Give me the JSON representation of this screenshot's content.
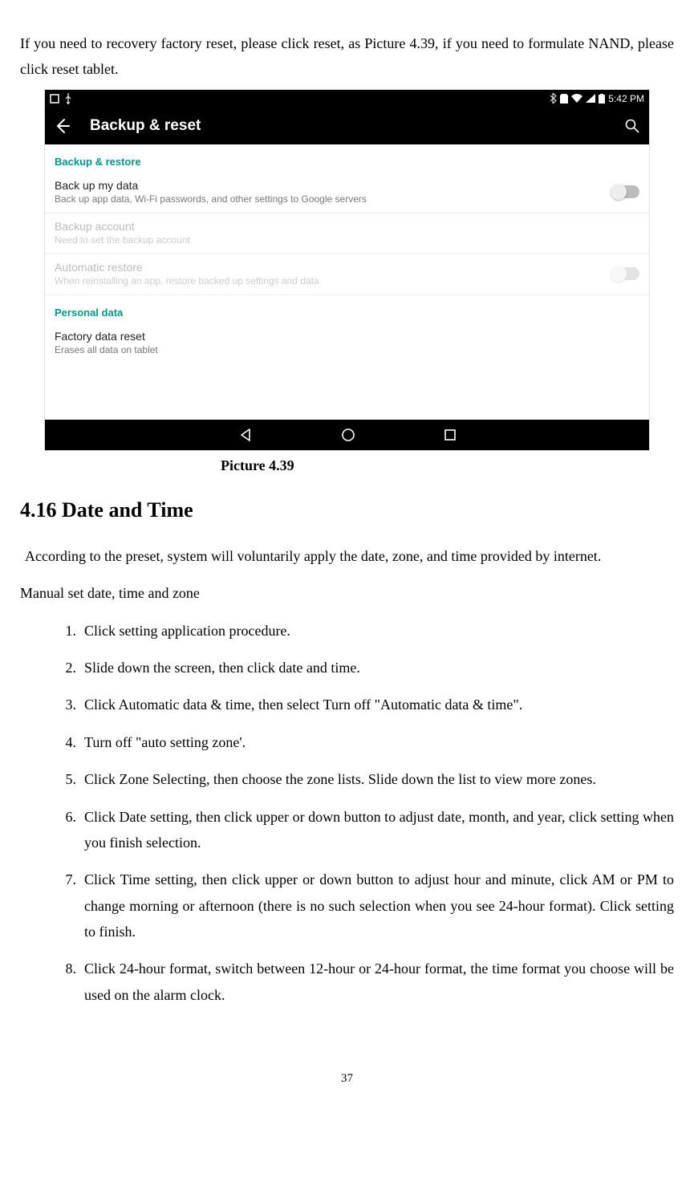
{
  "intro": "If you need to recovery factory reset, please click reset, as Picture 4.39, if you need to formulate NAND, please click reset tablet.",
  "screenshot": {
    "status_time": "5:42 PM",
    "appbar_title": "Backup & reset",
    "section1_header": "Backup & restore",
    "row1_title": "Back up my data",
    "row1_sub": "Back up app data, Wi-Fi passwords, and other settings to Google servers",
    "row2_title": "Backup account",
    "row2_sub": "Need to set the backup account",
    "row3_title": "Automatic restore",
    "row3_sub": "When reinstalling an app, restore backed up settings and data",
    "section2_header": "Personal data",
    "row4_title": "Factory data reset",
    "row4_sub": "Erases all data on tablet"
  },
  "caption": "Picture 4.39",
  "section_title": "4.16 Date and Time",
  "para1": "According to the preset, system will voluntarily apply the date, zone, and time provided by internet.",
  "para2": "Manual set date, time and zone",
  "steps": [
    "Click setting application procedure.",
    "Slide down the screen, then click date and time.",
    "Click Automatic data & time, then select Turn off \"Automatic data & time\".",
    "Turn off \"auto setting zone'.",
    "Click Zone Selecting, then choose the zone lists. Slide down the list to view more zones.",
    "Click Date setting, then click upper or down button to adjust date, month, and year, click setting when you finish selection.",
    "Click Time setting, then click upper or down button to adjust hour and minute, click AM or PM to change morning or afternoon (there is no such selection when you see 24-hour format). Click setting to finish.",
    "Click 24-hour format, switch between 12-hour or 24-hour format, the time format you choose will be used on the alarm clock."
  ],
  "page_number": "37"
}
